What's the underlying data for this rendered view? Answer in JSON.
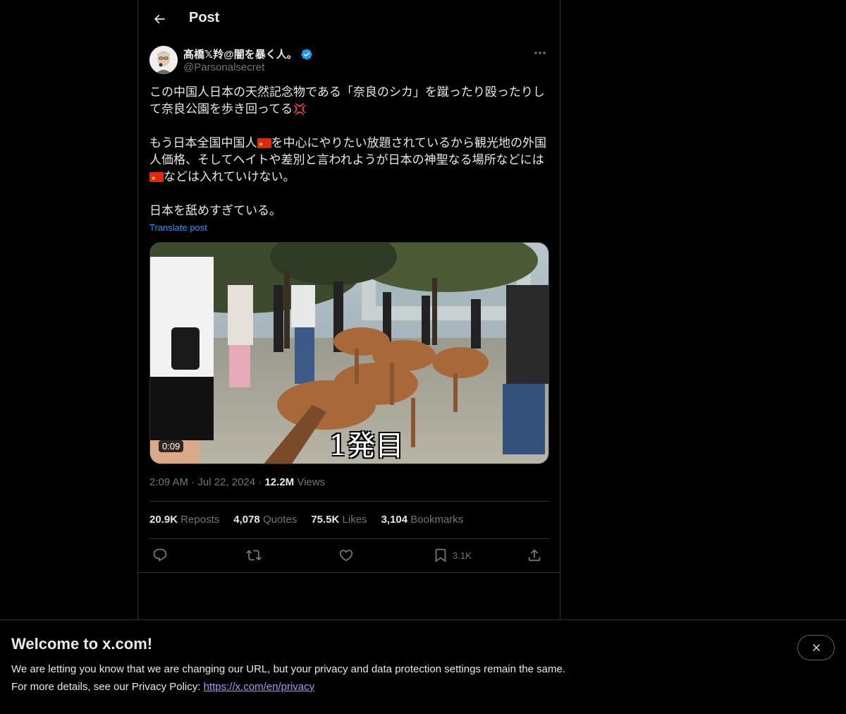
{
  "header": {
    "title": "Post"
  },
  "author": {
    "display_name": "髙橋𝕏羚@闇を暴く人。",
    "handle": "@Parsonalsecret",
    "verified": true
  },
  "post": {
    "line1": "この中国人日本の天然記念物である「奈良のシカ」を蹴ったり殴ったりして奈良公園を歩き回ってる",
    "line2a": "もう日本全国中国人",
    "line2b": "を中心にやりたい放題されているから観光地の外国人価格、そしてヘイトや差別と言われようが日本の神聖なる場所などには",
    "line2c": "などは入れていけない。",
    "line3": "日本を舐めすぎている。",
    "translate_label": "Translate post"
  },
  "media": {
    "duration": "0:09",
    "caption": "1発目"
  },
  "meta": {
    "time": "2:09 AM",
    "date": "Jul 22, 2024",
    "views_count": "12.2M",
    "views_label": "Views"
  },
  "stats": {
    "reposts_count": "20.9K",
    "reposts_label": "Reposts",
    "quotes_count": "4,078",
    "quotes_label": "Quotes",
    "likes_count": "75.5K",
    "likes_label": "Likes",
    "bookmarks_count": "3,104",
    "bookmarks_label": "Bookmarks"
  },
  "actions": {
    "bookmark_count": "3.1K"
  },
  "banner": {
    "title": "Welcome to x.com!",
    "line1": "We are letting you know that we are changing our URL, but your privacy and data protection settings remain the same.",
    "line2_prefix": "For more details, see our Privacy Policy: ",
    "link": "https://x.com/en/privacy"
  },
  "colors": {
    "accent": "#1d9bf0",
    "link": "#a09cf7",
    "background": "#000000",
    "flag": "#de2910"
  }
}
